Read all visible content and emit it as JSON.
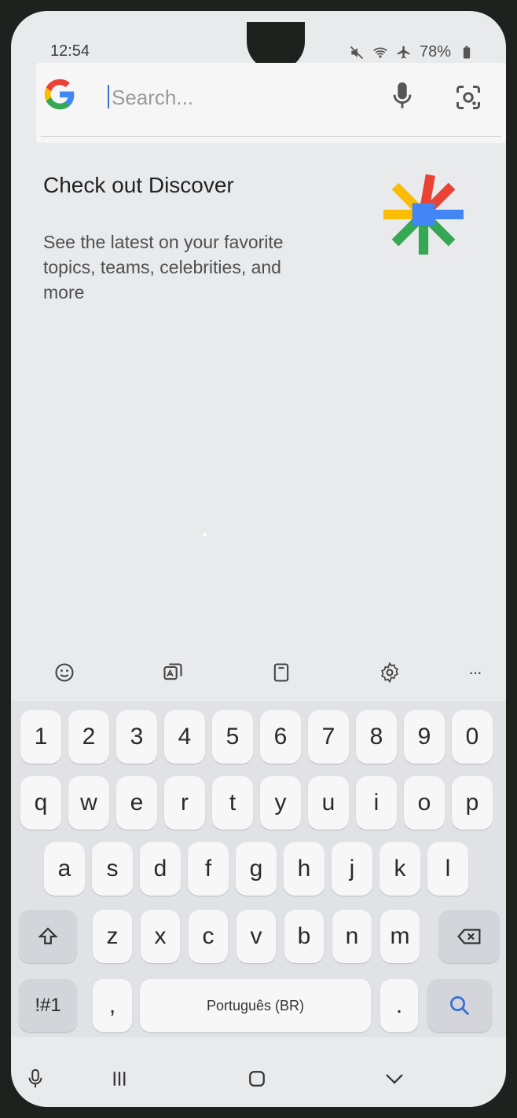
{
  "status_bar": {
    "time": "12:54",
    "battery": "78%"
  },
  "search": {
    "placeholder": "Search..."
  },
  "discover": {
    "title": "Check out Discover",
    "body": "See the latest on your favorite topics, teams, celebrities, and more"
  },
  "keyboard": {
    "row_numbers": [
      "1",
      "2",
      "3",
      "4",
      "5",
      "6",
      "7",
      "8",
      "9",
      "0"
    ],
    "row_top": [
      "q",
      "w",
      "e",
      "r",
      "t",
      "y",
      "u",
      "i",
      "o",
      "p"
    ],
    "row_middle": [
      "a",
      "s",
      "d",
      "f",
      "g",
      "h",
      "j",
      "k",
      "l"
    ],
    "row_bottom": [
      "z",
      "x",
      "c",
      "v",
      "b",
      "n",
      "m"
    ],
    "symbols_label": "!#1",
    "comma_label": ",",
    "space_label": "Português (BR)",
    "period_label": "."
  },
  "toolbar": {
    "icons": [
      "emoji-icon",
      "image-text-icon",
      "clipboard-icon",
      "settings-icon",
      "more-icon"
    ],
    "more_label": "···"
  },
  "colors": {
    "accent": "#3a6fd8",
    "google_blue": "#4285F4",
    "google_red": "#EA4335",
    "google_yellow": "#FBBC05",
    "google_green": "#34A853"
  }
}
